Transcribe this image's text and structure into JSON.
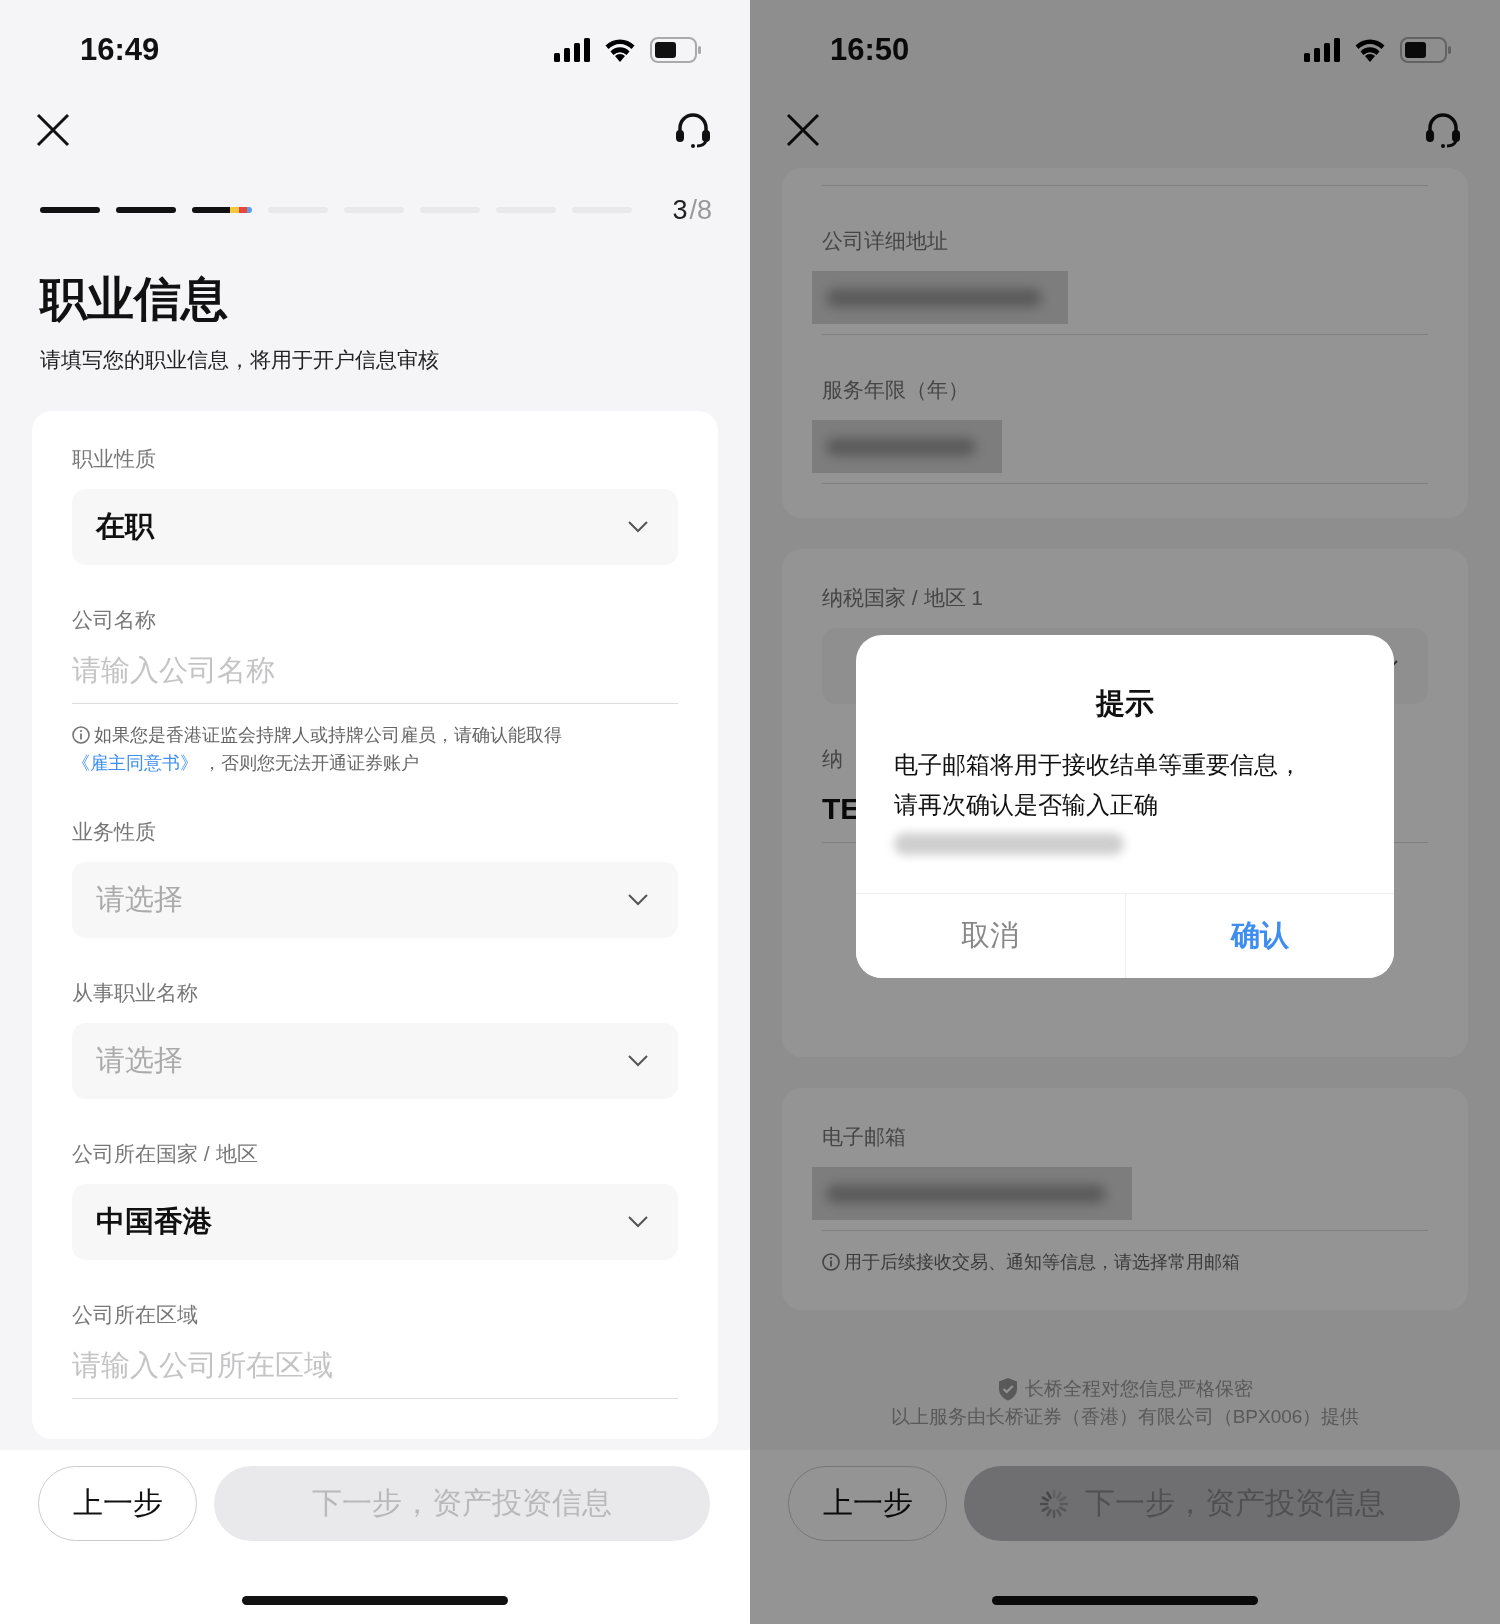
{
  "screens": [
    {
      "dimmed": false,
      "status_bar": {
        "time": "16:49"
      },
      "progress": {
        "steps": [
          {
            "kind": "done"
          },
          {
            "kind": "done"
          },
          {
            "kind": "current"
          },
          {
            "kind": "todo"
          },
          {
            "kind": "todo"
          },
          {
            "kind": "todo"
          },
          {
            "kind": "todo"
          },
          {
            "kind": "todo"
          }
        ],
        "current": "3",
        "total": "/8"
      },
      "title": "职业信息",
      "subtitle": "请填写您的职业信息，将用于开户信息审核",
      "cards": [
        {
          "fields": [
            {
              "kind": "select",
              "label": "职业性质",
              "value": "在职"
            },
            {
              "kind": "input",
              "label": "公司名称",
              "placeholder": "请输入公司名称",
              "note": {
                "text": "如果您是香港证监会持牌人或持牌公司雇员，请确认能取得 ",
                "link": "《雇主同意书》",
                "tail": " ，否则您无法开通证券账户"
              }
            },
            {
              "kind": "select",
              "label": "业务性质",
              "placeholder": "请选择"
            },
            {
              "kind": "select",
              "label": "从事职业名称",
              "placeholder": "请选择"
            },
            {
              "kind": "select",
              "label": "公司所在国家 / 地区",
              "value": "中国香港"
            },
            {
              "kind": "input",
              "label": "公司所在区域",
              "placeholder": "请输入公司所在区域"
            }
          ]
        }
      ],
      "buttons": {
        "back": "上一步",
        "next": {
          "label": "下一步，资产投资信息",
          "disabled": true,
          "loading": false
        }
      }
    },
    {
      "dimmed": true,
      "status_bar": {
        "time": "16:50"
      },
      "cards": [
        {
          "cut_top": true,
          "fields": [
            {
              "kind": "redacted",
              "label": "公司详细地址"
            },
            {
              "kind": "redacted",
              "label": "服务年限（年）"
            }
          ]
        },
        {
          "fields": [
            {
              "kind": "select",
              "label": "纳税国家 / 地区 1"
            },
            {
              "kind": "input",
              "label": "纳",
              "value": "TE"
            }
          ]
        },
        {
          "fields": [
            {
              "kind": "redacted",
              "label": "电子邮箱",
              "note": {
                "text": "用于后续接收交易、通知等信息，请选择常用邮箱"
              }
            }
          ]
        }
      ],
      "footer": {
        "secure": "长桥全程对您信息严格保密",
        "provider": "以上服务由长桥证券（香港）有限公司（BPX006）提供"
      },
      "buttons": {
        "back": "上一步",
        "next": {
          "label": "下一步，资产投资信息",
          "disabled": true,
          "loading": true
        }
      },
      "dialog": {
        "title": "提示",
        "message": "电子邮箱将用于接收结单等重要信息，请再次确认是否输入正确",
        "buttons": [
          {
            "kind": "cancel",
            "label": "取消"
          },
          {
            "kind": "confirm",
            "label": "确认"
          }
        ]
      }
    }
  ]
}
